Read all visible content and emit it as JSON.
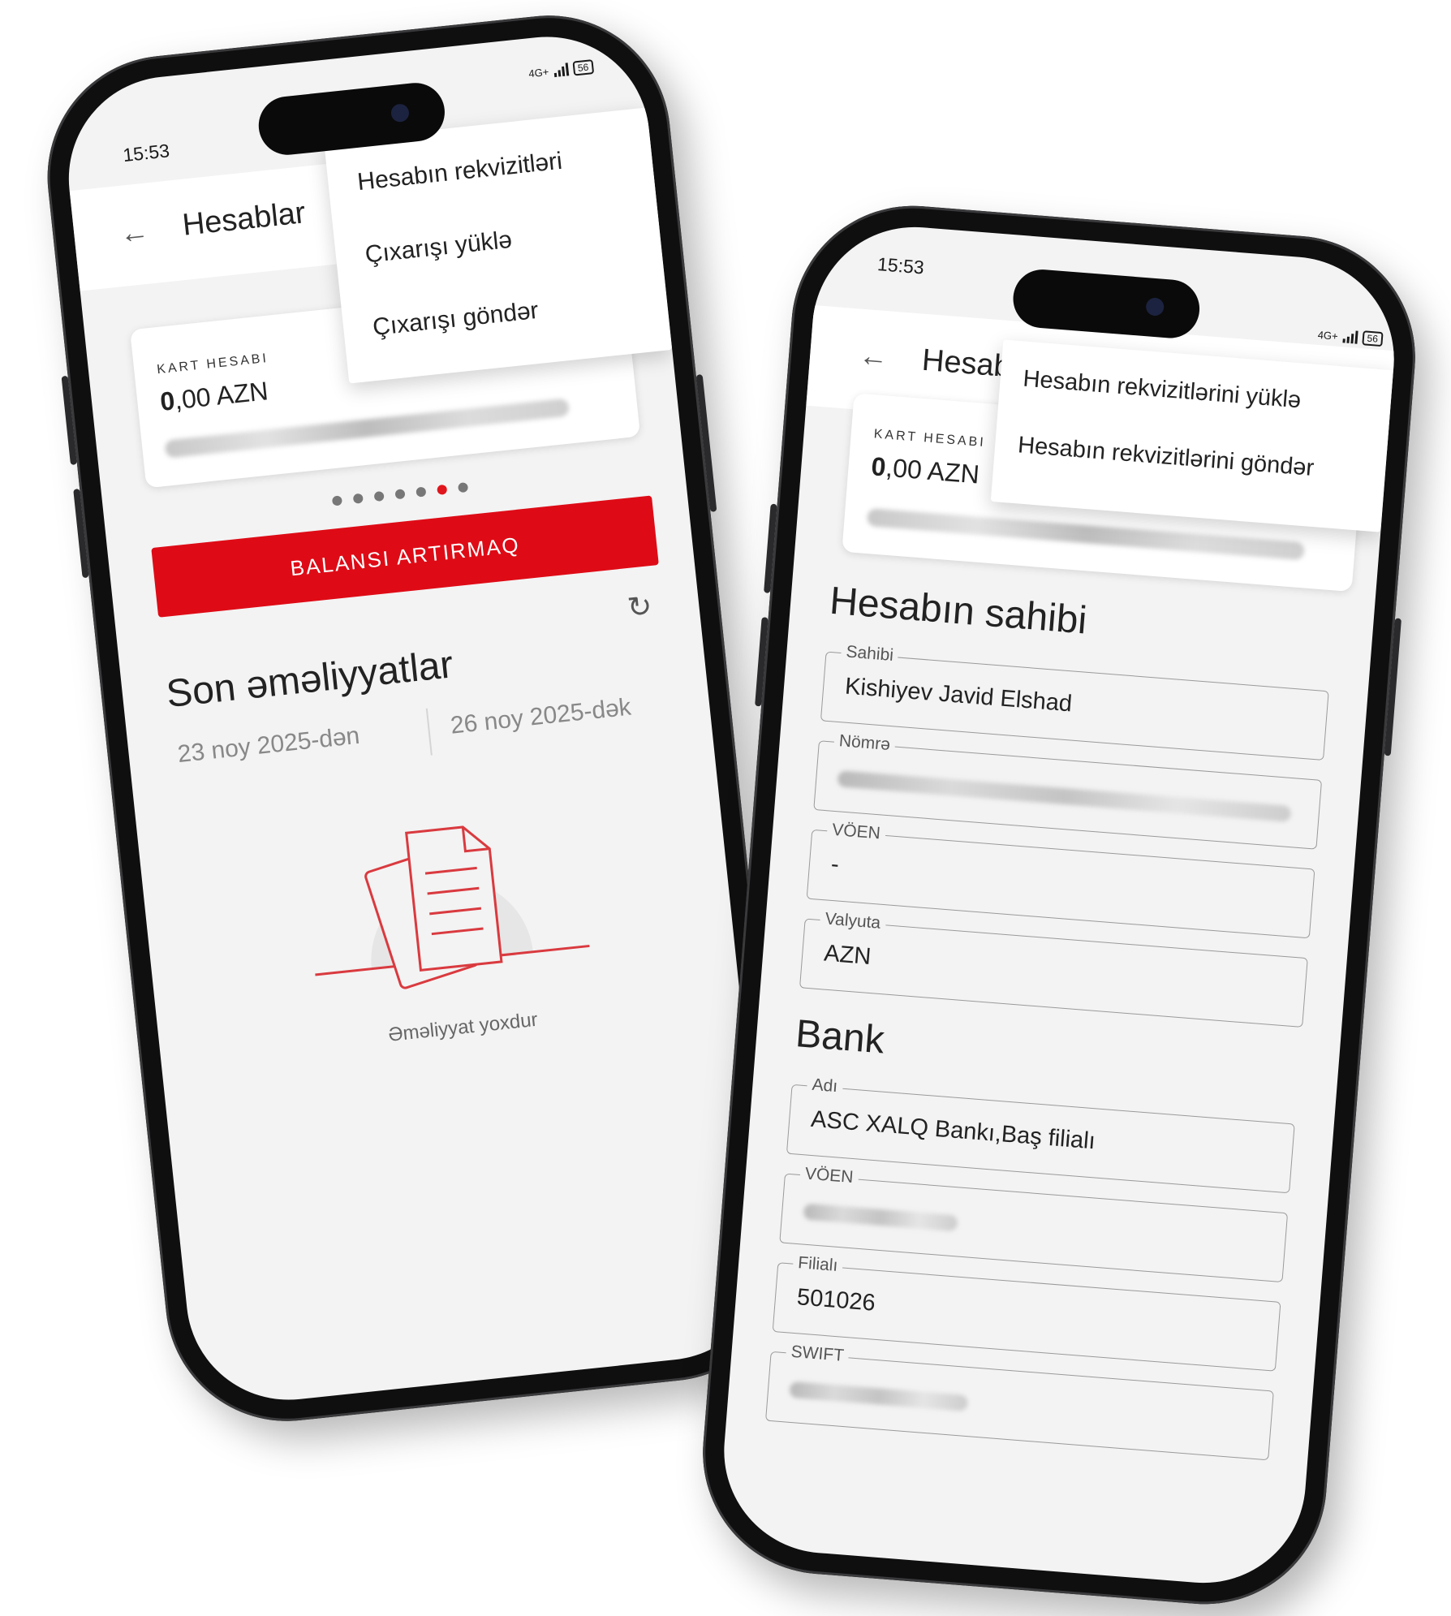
{
  "left_phone": {
    "status": {
      "time": "15:53",
      "network": "4G+",
      "battery": "56"
    },
    "appbar": {
      "title": "Hesablar"
    },
    "menu": {
      "items": [
        "Hesabın rekvizitləri",
        "Çıxarışı yüklə",
        "Çıxarışı göndər"
      ]
    },
    "card": {
      "label": "KART HESABI",
      "amount_int": "0",
      "amount_rest": ",00 AZN"
    },
    "pager": {
      "total": 7,
      "active_index": 5
    },
    "topup_button": "BALANSI ARTIRMAQ",
    "recent": {
      "title": "Son əməliyyatlar",
      "date_from": "23 noy 2025-dən",
      "date_to": "26 noy 2025-dək",
      "empty_text": "Əməliyyat yoxdur"
    }
  },
  "right_phone": {
    "status": {
      "time": "15:53",
      "network": "4G+",
      "battery": "56"
    },
    "appbar": {
      "title": "Hesab"
    },
    "menu": {
      "items": [
        "Hesabın rekvizitlərini yüklə",
        "Hesabın rekvizitlərini göndər"
      ]
    },
    "card": {
      "label": "KART HESABI",
      "amount_int": "0",
      "amount_rest": ",00 AZN"
    },
    "owner_section": {
      "title": "Hesabın sahibi",
      "fields": [
        {
          "label": "Sahibi",
          "value": "Kishiyev Javid Elshad"
        },
        {
          "label": "Nömrə",
          "value": ""
        },
        {
          "label": "VÖEN",
          "value": "-"
        },
        {
          "label": "Valyuta",
          "value": "AZN"
        }
      ]
    },
    "bank_section": {
      "title": "Bank",
      "fields": [
        {
          "label": "Adı",
          "value": "ASC XALQ Bankı,Baş filialı"
        },
        {
          "label": "VÖEN",
          "value": ""
        },
        {
          "label": "Filialı",
          "value": "501026"
        },
        {
          "label": "SWIFT",
          "value": ""
        }
      ]
    },
    "accent_color": "#de0b16"
  }
}
